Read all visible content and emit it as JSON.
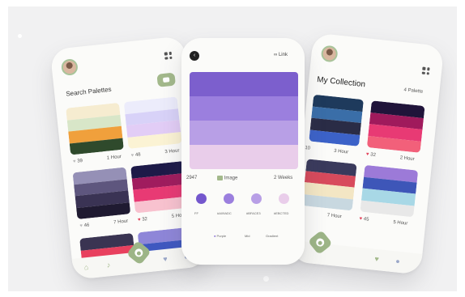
{
  "colors": {
    "accent_green": "#a3b98b",
    "heart_red": "#e2425a",
    "background": "#f1f1f2"
  },
  "left_phone": {
    "search_label": "Search Palettes",
    "search_button_icon": "search-icon",
    "palettes": [
      {
        "colors": [
          "#f6ecd0",
          "#d8e6c8",
          "#f0a03c",
          "#2f4a2c"
        ],
        "likes": "39",
        "time": "1 Hour",
        "liked": false
      },
      {
        "colors": [
          "#ececfb",
          "#d8d2f8",
          "#e2cdf6",
          "#fbf3d4"
        ],
        "likes": "48",
        "time": "3 Hour",
        "liked": false
      },
      {
        "colors": [
          "#9590b6",
          "#5e567e",
          "#3a3354",
          "#1f1a31"
        ],
        "likes": "46",
        "time": "7 Hour",
        "liked": false
      },
      {
        "colors": [
          "#1d1a48",
          "#a01c5e",
          "#e83a74",
          "#f8c2cf"
        ],
        "likes": "32",
        "time": "5 Hour",
        "liked": true
      },
      {
        "colors": [
          "#3a3452",
          "#e8405e"
        ],
        "likes": "",
        "time": "",
        "liked": false
      },
      {
        "colors": [
          "#8e86d8",
          "#3f58c0"
        ],
        "likes": "",
        "time": "",
        "liked": false
      }
    ],
    "nav_icons": [
      "home-icon",
      "mic-icon",
      "add-icon",
      "heart-icon",
      "profile-icon"
    ]
  },
  "center_phone": {
    "back_icon": "back-icon",
    "link_label": "Link",
    "stripes": [
      "#7c5fcd",
      "#9b7fde",
      "#b89fe6",
      "#e9cdea"
    ],
    "like_count": "2947",
    "type_label": "Image",
    "time": "2 Weeks",
    "swatches": [
      {
        "color": "#7457cd",
        "hex": "FF"
      },
      {
        "color": "#9b7fde",
        "hex": "#A09ADC"
      },
      {
        "color": "#b89fe6",
        "hex": "#BFACE3"
      },
      {
        "color": "#e9cdea",
        "hex": "#EBCTED"
      }
    ],
    "tags": [
      "Purple",
      "Mid",
      "Gradient"
    ]
  },
  "right_phone": {
    "title": "My Collection",
    "count": "4 Palette",
    "palettes": [
      {
        "colors": [
          "#1e3a5c",
          "#3a6ea8",
          "#2a2c46",
          "#3c62c8"
        ],
        "likes": "10",
        "time": "3 Hour",
        "liked": false
      },
      {
        "colors": [
          "#20143a",
          "#a01a5c",
          "#e83a74",
          "#f2607a"
        ],
        "likes": "32",
        "time": "2 Hour",
        "liked": true
      },
      {
        "colors": [
          "#3a3a5c",
          "#d84a5c",
          "#f3e6c4",
          "#c8d8e0"
        ],
        "likes": "",
        "time": "7 Hour",
        "liked": false
      },
      {
        "colors": [
          "#9c7ad8",
          "#3e56b8",
          "#a8d8e6",
          "#e8e8e8"
        ],
        "likes": "45",
        "time": "5 Hour",
        "liked": true
      }
    ],
    "nav_icons": [
      "home-icon",
      "add-icon",
      "heart-icon",
      "profile-icon"
    ]
  }
}
